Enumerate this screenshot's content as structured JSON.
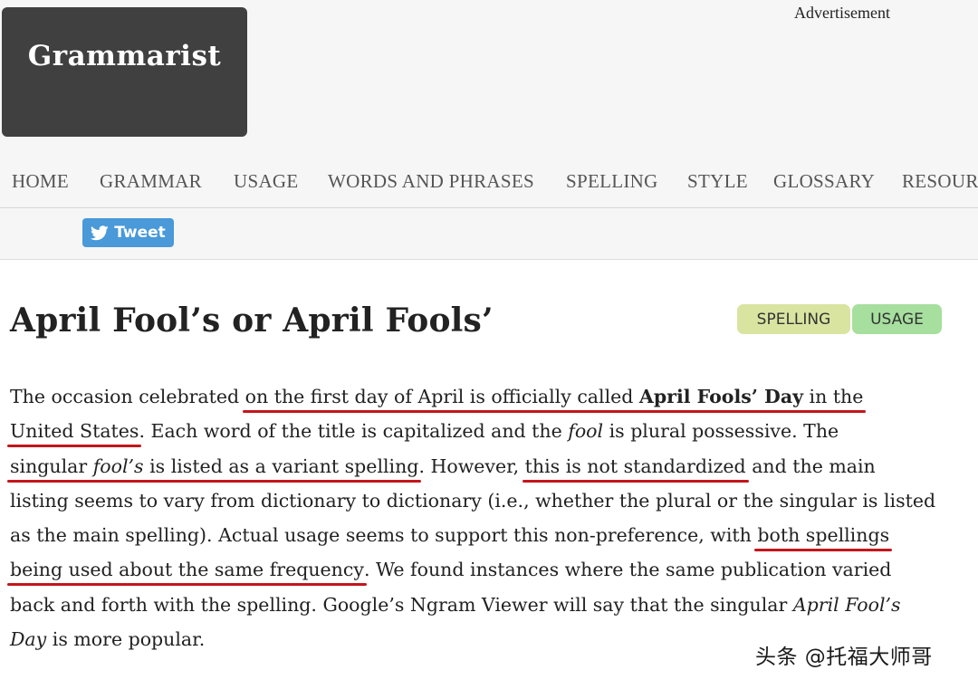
{
  "site": {
    "logo_text": "Grammarist",
    "ad_label": "Advertisement"
  },
  "nav": {
    "items": [
      {
        "label": "HOME"
      },
      {
        "label": "GRAMMAR"
      },
      {
        "label": "USAGE"
      },
      {
        "label": "WORDS AND PHRASES"
      },
      {
        "label": "SPELLING"
      },
      {
        "label": "STYLE"
      },
      {
        "label": "GLOSSARY"
      },
      {
        "label": "RESOUR"
      }
    ]
  },
  "share": {
    "tweet_label": "Tweet",
    "icon": "twitter-bird-icon"
  },
  "article": {
    "title": "April Fool’s or April Fools’",
    "tags": [
      "SPELLING",
      "USAGE"
    ],
    "body": {
      "l1_a": "The occasion celebrated ",
      "l1_u": "on the first day of April is officially called ",
      "l1_b": "April Fools’ Day",
      "l1_c": " in the",
      "l2_u": "United States",
      "l2_a": ". Each word of the title is capitalized and the ",
      "l2_i": "fool",
      "l2_c": " is plural possessive. The",
      "l3_u1": "singular ",
      "l3_i": "fool’s",
      "l3_u2": " is listed as a variant spelling",
      "l3_a": ". However, ",
      "l3_u3": "this is not standardized",
      "l3_c": " and the main",
      "l4": "listing seems to vary from dictionary to dictionary (i.e., whether the plural or the singular is listed",
      "l5_a": "as the main spelling). Actual usage seems to support this non-preference, with ",
      "l5_u": "both spellings",
      "l6_u": "being used about the same frequency",
      "l6_a": ". We found instances where the same publication varied",
      "l7_a": "back and forth with the spelling. Google’s Ngram Viewer will say that the singular ",
      "l7_i": "April Fool’s",
      "l8_i": "Day",
      "l8_a": " is more popular."
    },
    "underline_color": "#c3161c"
  },
  "watermark": "头条 @托福大师哥"
}
